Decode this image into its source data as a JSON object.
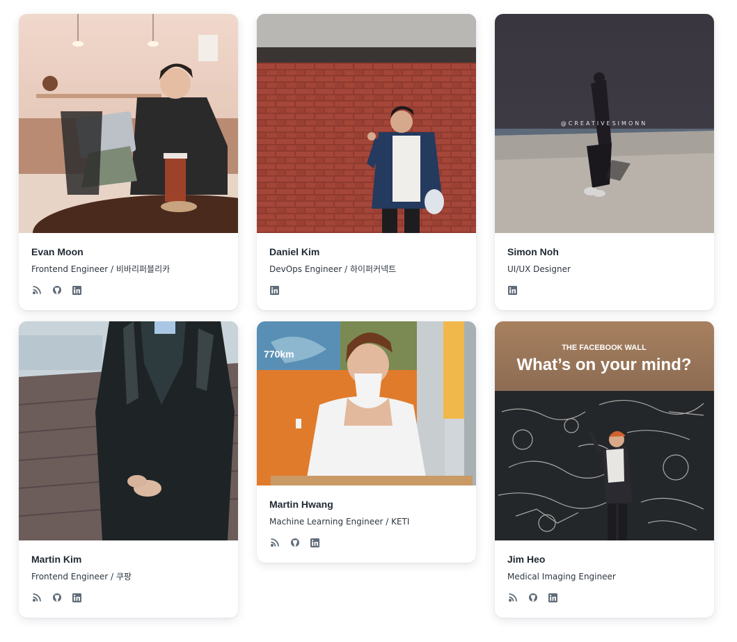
{
  "members": [
    {
      "name": "Evan Moon",
      "role": "Frontend Engineer / 비바리퍼블리카",
      "links": [
        "blog-icon",
        "github-icon",
        "linkedin-icon"
      ]
    },
    {
      "name": "Daniel Kim",
      "role": "DevOps Engineer / 하이퍼커넥트",
      "links": [
        "linkedin-icon"
      ]
    },
    {
      "name": "Simon Noh",
      "role": "UI/UX Designer",
      "links": [
        "linkedin-icon"
      ],
      "photo_watermark": "@CREATIVESIMONN"
    },
    {
      "name": "Martin Kim",
      "role": "Frontend Engineer / 쿠팡",
      "links": [
        "blog-icon",
        "github-icon",
        "linkedin-icon"
      ]
    },
    {
      "name": "Martin Hwang",
      "role": "Machine Learning Engineer / KETI",
      "links": [
        "blog-icon",
        "github-icon",
        "linkedin-icon"
      ],
      "photo_map_label": "770km"
    },
    {
      "name": "Jim Heo",
      "role": "Medical Imaging Engineer",
      "links": [
        "blog-icon",
        "github-icon",
        "linkedin-icon"
      ],
      "photo_sign_top": "THE FACEBOOK WALL",
      "photo_sign_main": "What’s on your mind?"
    }
  ],
  "colors": {
    "icon": "#5f6b77",
    "name": "#1f2933",
    "role": "#2d3640"
  }
}
